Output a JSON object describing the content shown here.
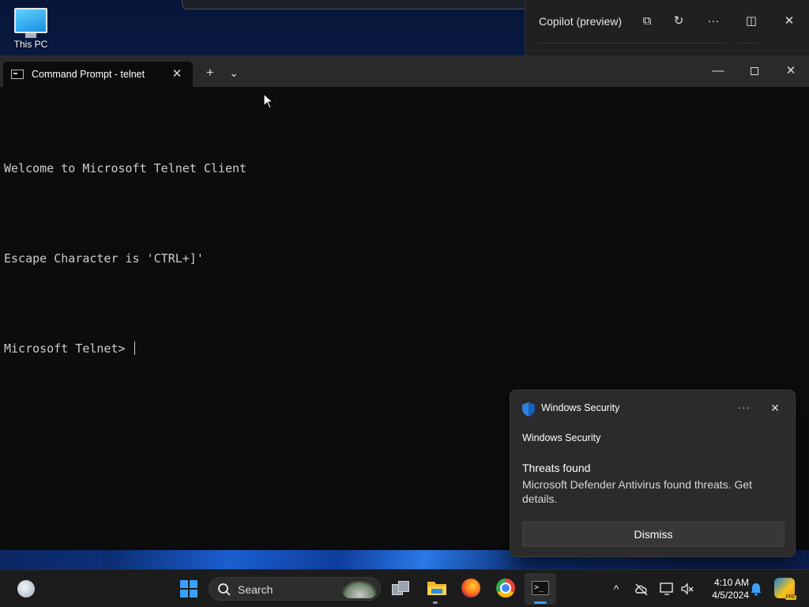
{
  "desktop": {
    "icons": [
      {
        "label": "This PC",
        "icon": "monitor-icon"
      }
    ]
  },
  "copilot": {
    "title": "Copilot (preview)",
    "buttons": [
      {
        "name": "open-external",
        "glyph": "⧉"
      },
      {
        "name": "refresh",
        "glyph": "↻"
      },
      {
        "name": "more",
        "glyph": "···"
      },
      {
        "name": "dock",
        "glyph": "◫"
      },
      {
        "name": "close",
        "glyph": "✕"
      }
    ]
  },
  "terminal": {
    "tab_title": "Command Prompt - telnet",
    "tab_close_glyph": "✕",
    "new_tab_glyph": "+",
    "dropdown_glyph": "⌄",
    "minimize_glyph": "—",
    "close_glyph": "✕",
    "lines": [
      "Welcome to Microsoft Telnet Client",
      "Escape Character is 'CTRL+]'",
      "Microsoft Telnet> "
    ]
  },
  "notification": {
    "app_name": "Windows Security",
    "attribution": "Windows Security",
    "heading": "Threats found",
    "body": "Microsoft Defender Antivirus found threats. Get details.",
    "more_glyph": "···",
    "close_glyph": "✕",
    "dismiss_label": "Dismiss"
  },
  "taskbar": {
    "search_label": "Search",
    "clock_time": "4:10 AM",
    "clock_date": "4/5/2024",
    "chevron_glyph": "^",
    "copilot_badge": "PRE",
    "terminal_glyph": ">_",
    "accent_color": "#3aa0ff"
  }
}
